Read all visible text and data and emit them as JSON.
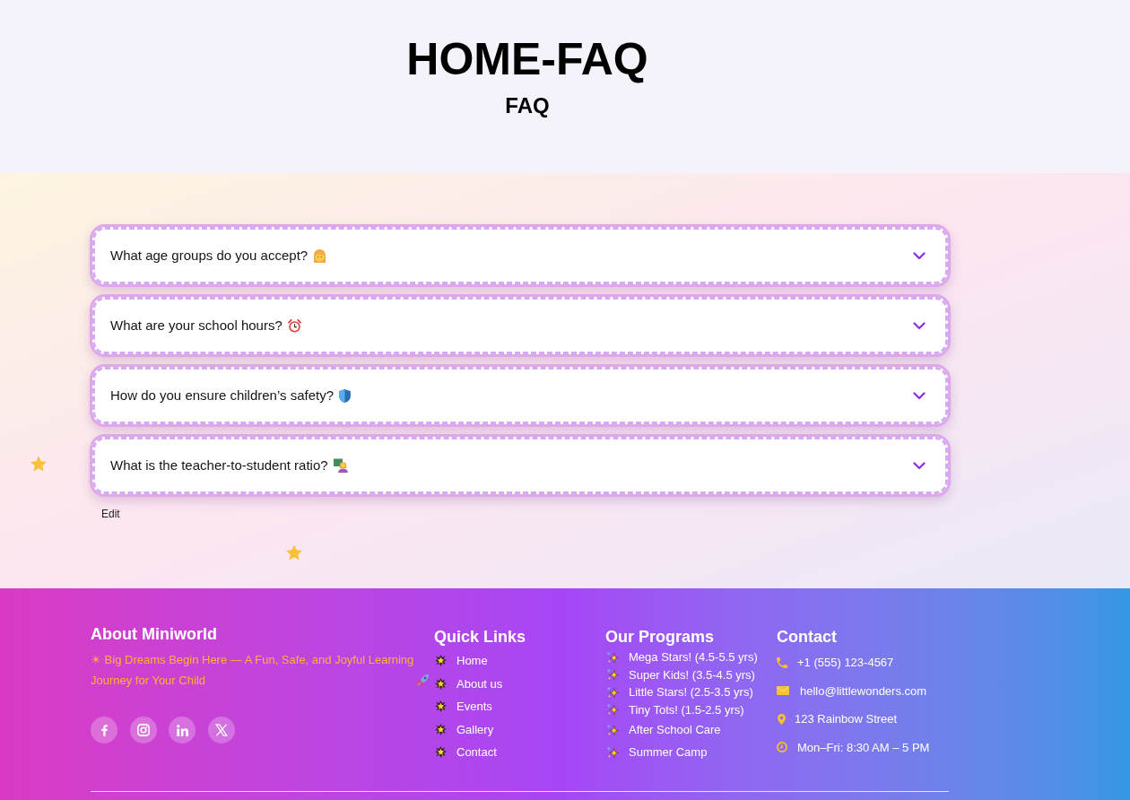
{
  "header": {
    "title": "HOME-FAQ",
    "subtitle": "FAQ"
  },
  "faq": {
    "items": [
      {
        "question": "What age groups do you accept?",
        "expanded": false
      },
      {
        "question": "What are your school hours?",
        "expanded": false
      },
      {
        "question": "How do you ensure children’s safety?",
        "expanded": false
      },
      {
        "question": "What is the teacher-to-student ratio?",
        "expanded": false
      }
    ],
    "edit_link": "Edit"
  },
  "footer": {
    "about": {
      "heading": "About Miniworld",
      "text": "☀ Big Dreams Begin Here — A Fun, Safe, and Joyful Learning Journey for Your Child"
    },
    "quick_links": {
      "heading": "Quick Links",
      "items": [
        "Home",
        "About us",
        "Events",
        "Gallery",
        "Contact"
      ]
    },
    "programs": {
      "heading": "Our Programs",
      "items": [
        {
          "label": "Mega Stars! (4.5-5.5 yrs)",
          "kind": "age_group"
        },
        {
          "label": "Super Kids! (3.5-4.5 yrs)",
          "kind": "age_group"
        },
        {
          "label": "Little Stars! (2.5-3.5 yrs)",
          "kind": "age_group"
        },
        {
          "label": "Tiny Tots! (1.5-2.5 yrs)",
          "kind": "age_group"
        },
        {
          "label": "After School Care",
          "kind": "activity"
        },
        {
          "label": "Summer Camp",
          "kind": "activity"
        }
      ]
    },
    "contact": {
      "heading": "Contact",
      "items": [
        {
          "text": "+1 (555) 123-4567",
          "kind": "phone"
        },
        {
          "text": "hello@littlewonders.com",
          "kind": "email"
        },
        {
          "text": "123 Rainbow Street",
          "kind": "address"
        },
        {
          "text": "Mon–Fri: 8:30 AM – 5 PM",
          "kind": "hours"
        }
      ]
    }
  }
}
